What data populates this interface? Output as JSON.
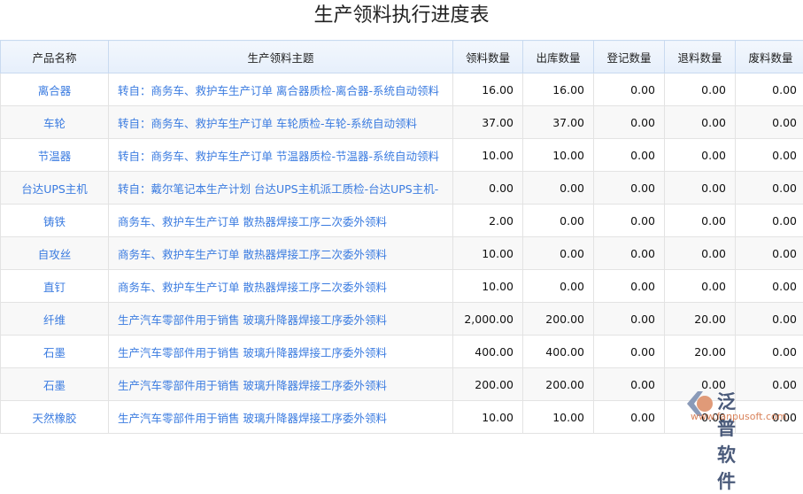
{
  "title": "生产领料执行进度表",
  "headers": [
    "产品名称",
    "生产领料主题",
    "领料数量",
    "出库数量",
    "登记数量",
    "退料数量",
    "废料数量"
  ],
  "rows": [
    [
      "离合器",
      "转自：商务车、救护车生产订单 离合器质检-离合器-系统自动领料",
      "16.00",
      "16.00",
      "0.00",
      "0.00",
      "0.00"
    ],
    [
      "车轮",
      "转自：商务车、救护车生产订单 车轮质检-车轮-系统自动领料",
      "37.00",
      "37.00",
      "0.00",
      "0.00",
      "0.00"
    ],
    [
      "节温器",
      "转自：商务车、救护车生产订单 节温器质检-节温器-系统自动领料",
      "10.00",
      "10.00",
      "0.00",
      "0.00",
      "0.00"
    ],
    [
      "台达UPS主机",
      "转自：戴尔笔记本生产计划 台达UPS主机派工质检-台达UPS主机-",
      "0.00",
      "0.00",
      "0.00",
      "0.00",
      "0.00"
    ],
    [
      "铸铁",
      "商务车、救护车生产订单 散热器焊接工序二次委外领料",
      "2.00",
      "0.00",
      "0.00",
      "0.00",
      "0.00"
    ],
    [
      "自攻丝",
      "商务车、救护车生产订单 散热器焊接工序二次委外领料",
      "10.00",
      "0.00",
      "0.00",
      "0.00",
      "0.00"
    ],
    [
      "直钉",
      "商务车、救护车生产订单 散热器焊接工序二次委外领料",
      "10.00",
      "0.00",
      "0.00",
      "0.00",
      "0.00"
    ],
    [
      "纤维",
      "生产汽车零部件用于销售 玻璃升降器焊接工序委外领料",
      "2,000.00",
      "200.00",
      "0.00",
      "20.00",
      "0.00"
    ],
    [
      "石墨",
      "生产汽车零部件用于销售 玻璃升降器焊接工序委外领料",
      "400.00",
      "400.00",
      "0.00",
      "20.00",
      "0.00"
    ],
    [
      "石墨",
      "生产汽车零部件用于销售 玻璃升降器焊接工序委外领料",
      "200.00",
      "200.00",
      "0.00",
      "0.00",
      "0.00"
    ],
    [
      "天然橡胶",
      "生产汽车零部件用于销售 玻璃升降器焊接工序委外领料",
      "10.00",
      "10.00",
      "0.00",
      "0.00",
      "0.00"
    ]
  ],
  "watermark": {
    "cn": "泛普软件",
    "en": "www.fanpusoft.com"
  }
}
